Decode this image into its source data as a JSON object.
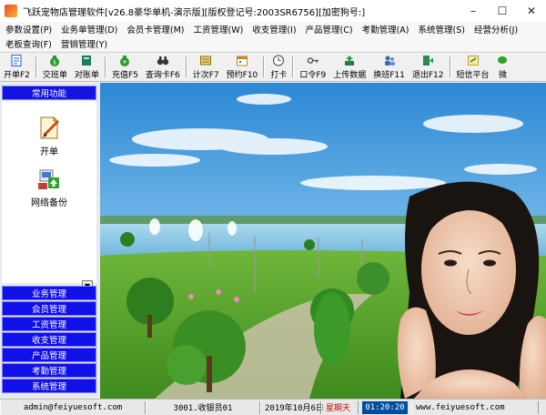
{
  "window": {
    "title": "飞跃宠物店管理软件[v26.8豪华单机-演示版][版权登记号:2003SR6756][加密狗号:]",
    "minimize_glyph": "–",
    "maximize_glyph": "☐",
    "close_glyph": "✕"
  },
  "menu": {
    "row1": [
      "参数设置(P)",
      "业务单管理(D)",
      "会员卡管理(M)",
      "工资管理(W)",
      "收支管理(I)",
      "产品管理(C)",
      "考勤管理(A)",
      "系统管理(S)",
      "经营分析(J)"
    ],
    "row2": [
      "老板查询(F)",
      "营销管理(Y)"
    ]
  },
  "toolbar": [
    {
      "label": "开单F2",
      "icon": "document-icon",
      "color": "#1e5bd6"
    },
    {
      "label": "交班单",
      "icon": "money-bag-icon",
      "color": "#2c9a2c"
    },
    {
      "label": "对账单",
      "icon": "ledger-icon",
      "color": "#1d7c5a"
    },
    {
      "label": "充值F5",
      "icon": "coin-bag-icon",
      "color": "#2c9a2c"
    },
    {
      "label": "查询卡F6",
      "icon": "binoculars-icon",
      "color": "#333333"
    },
    {
      "label": "计次F7",
      "icon": "counter-icon",
      "color": "#8a6a14"
    },
    {
      "label": "预约F10",
      "icon": "calendar-icon",
      "color": "#c8862a"
    },
    {
      "label": "打卡",
      "icon": "clock-icon",
      "color": "#444444"
    },
    {
      "label": "口令F9",
      "icon": "key-icon",
      "color": "#555555"
    },
    {
      "label": "上传数据",
      "icon": "upload-icon",
      "color": "#2a7a3a"
    },
    {
      "label": "换班F11",
      "icon": "swap-user-icon",
      "color": "#3a6ab8"
    },
    {
      "label": "退出F12",
      "icon": "exit-icon",
      "color": "#2c8a4a"
    },
    {
      "label": "短信平台",
      "icon": "sms-icon",
      "color": "#c8a12a"
    },
    {
      "label": "微",
      "icon": "wechat-icon",
      "color": "#2aa52a"
    }
  ],
  "left_panel": {
    "header": "常用功能",
    "items": [
      {
        "label": "开单",
        "icon": "open-bill-icon"
      },
      {
        "label": "网络备份",
        "icon": "network-backup-icon"
      }
    ],
    "scroll_glyph": "▼",
    "categories": [
      "业务管理",
      "会员管理",
      "工资管理",
      "收支管理",
      "产品管理",
      "考勤管理",
      "系统管理"
    ]
  },
  "status": {
    "email": "admin@feiyuesoft.com",
    "cashier": "3001.收银员01",
    "date": "2019年10月6日",
    "weekday": "星期天",
    "time": "01:20:20",
    "website": "www.feiyuesoft.com"
  }
}
